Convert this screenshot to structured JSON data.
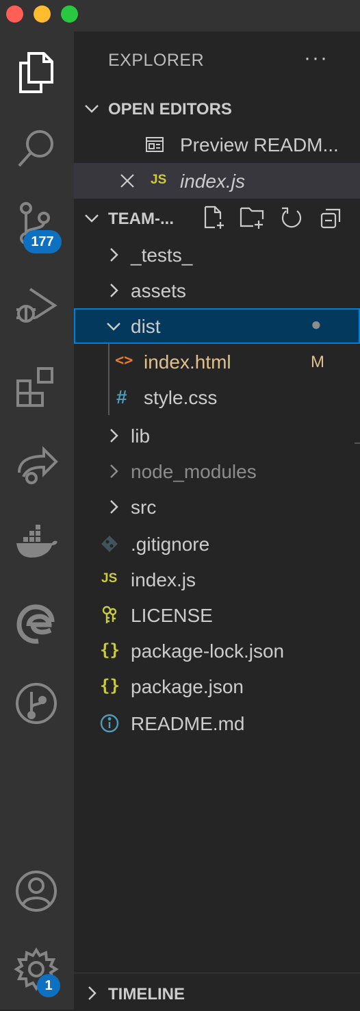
{
  "window": {
    "traffic_lights": [
      "close",
      "minimize",
      "maximize"
    ]
  },
  "activity_bar": {
    "items": [
      {
        "name": "explorer-icon",
        "active": true
      },
      {
        "name": "search-icon"
      },
      {
        "name": "source-control-icon",
        "badge": "177"
      },
      {
        "name": "run-debug-icon"
      },
      {
        "name": "extensions-icon"
      },
      {
        "name": "live-share-icon"
      },
      {
        "name": "docker-icon"
      },
      {
        "name": "edge-icon"
      },
      {
        "name": "git-graph-icon"
      }
    ],
    "bottom": [
      {
        "name": "account-icon"
      },
      {
        "name": "settings-gear-icon",
        "badge": "1"
      }
    ]
  },
  "explorer": {
    "title": "EXPLORER",
    "more": "···",
    "open_editors": {
      "label": "OPEN EDITORS",
      "items": [
        {
          "label": "Preview READM...",
          "icon": "preview-icon"
        },
        {
          "label": "index.js",
          "icon_text": "JS",
          "active": true
        }
      ]
    },
    "workspace": {
      "label": "TEAM-...",
      "actions": [
        "new-file-icon",
        "new-folder-icon",
        "refresh-icon",
        "collapse-all-icon"
      ],
      "tree": [
        {
          "label": "_tests_",
          "type": "folder"
        },
        {
          "label": "assets",
          "type": "folder"
        },
        {
          "label": "dist",
          "type": "folder",
          "expanded": true,
          "selected": true,
          "dot": "●"
        },
        {
          "label": "index.html",
          "type": "file",
          "icon_text": "<>",
          "status": "M"
        },
        {
          "label": "style.css",
          "type": "file",
          "icon_text": "#"
        },
        {
          "label": "lib",
          "type": "folder"
        },
        {
          "label": "node_modules",
          "type": "folder"
        },
        {
          "label": "src",
          "type": "folder"
        },
        {
          "label": ".gitignore",
          "type": "file"
        },
        {
          "label": "index.js",
          "type": "file",
          "icon_text": "JS"
        },
        {
          "label": "LICENSE",
          "type": "file"
        },
        {
          "label": "package-lock.json",
          "type": "file",
          "icon_text": "{}"
        },
        {
          "label": "package.json",
          "type": "file",
          "icon_text": "{}"
        },
        {
          "label": "README.md",
          "type": "file"
        }
      ]
    },
    "timeline": {
      "label": "TIMELINE"
    }
  },
  "colors": {
    "activity_bg": "#333333",
    "sidebar_bg": "#252526",
    "selection_bg": "#04395e",
    "focus_border": "#007fd4",
    "badge_bg": "#0e70c0",
    "modified": "#e2c08d",
    "js_yellow": "#cbcb41"
  }
}
